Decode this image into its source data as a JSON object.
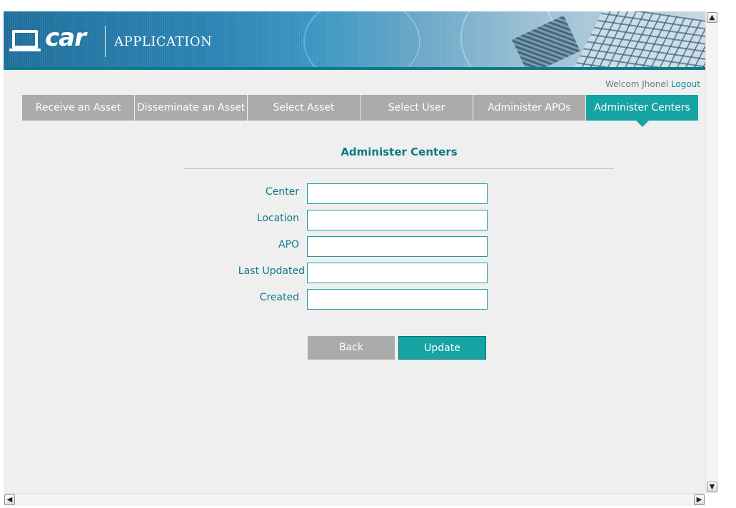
{
  "header": {
    "logo_text": "car",
    "app_name": "APPLICATION"
  },
  "userbar": {
    "welcome": "Welcom Jhonel",
    "logout": "Logout"
  },
  "nav": {
    "tabs": [
      {
        "label": "Receive an Asset",
        "active": false
      },
      {
        "label": "Disseminate an Asset",
        "active": false
      },
      {
        "label": "Select Asset",
        "active": false
      },
      {
        "label": "Select User",
        "active": false
      },
      {
        "label": "Administer APOs",
        "active": false
      },
      {
        "label": "Administer Centers",
        "active": true
      }
    ]
  },
  "main": {
    "title": "Administer Centers",
    "fields": [
      {
        "label": "Center",
        "value": ""
      },
      {
        "label": "Location",
        "value": ""
      },
      {
        "label": "APO",
        "value": ""
      },
      {
        "label": "Last Updated",
        "value": ""
      },
      {
        "label": "Created",
        "value": ""
      }
    ],
    "back_label": "Back",
    "update_label": "Update"
  },
  "colors": {
    "accent": "#16a3a3",
    "inactive_tab": "#ababab",
    "text_teal": "#0e7a84",
    "background": "#efefef"
  },
  "icons": {
    "logo": "monitor-icon",
    "scroll_up": "chevron-up-icon",
    "scroll_down": "chevron-down-icon",
    "scroll_left": "chevron-left-icon",
    "scroll_right": "chevron-right-icon"
  }
}
